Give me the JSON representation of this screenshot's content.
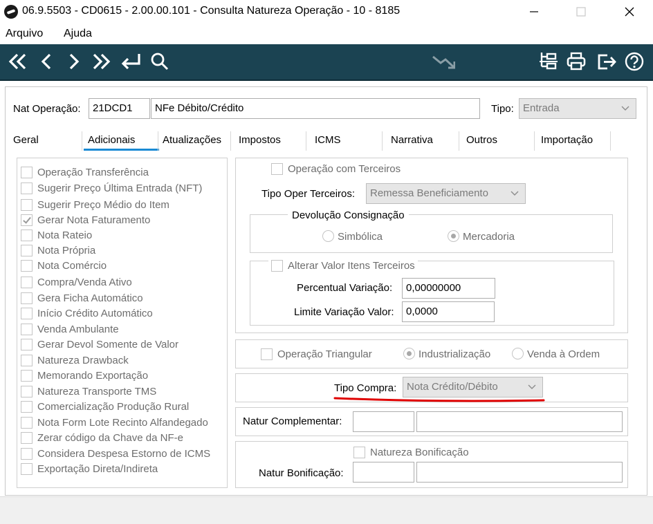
{
  "window": {
    "title": "06.9.5503 - CD0615 - 2.00.00.101 - Consulta Natureza Operação - 10 - 8185"
  },
  "menu": {
    "items": [
      "Arquivo",
      "Ajuda"
    ]
  },
  "toolbar": {
    "icons": [
      "first-icon",
      "prev-icon",
      "next-icon",
      "last-icon",
      "return-icon",
      "search-icon",
      "trend-down-icon",
      "tree-icon",
      "print-icon",
      "exit-icon",
      "help-icon"
    ]
  },
  "header": {
    "nat_label": "Nat Operação:",
    "nat_code": "21DCD1",
    "nat_desc": "NFe Débito/Crédito",
    "tipo_label": "Tipo:",
    "tipo_value": "Entrada"
  },
  "tabs": [
    "Geral",
    "Adicionais",
    "Atualizações",
    "Impostos",
    "ICMS",
    "Narrativa",
    "Outros",
    "Importação"
  ],
  "active_tab": "Adicionais",
  "checklist": [
    {
      "label": "Operação Transferência",
      "checked": false
    },
    {
      "label": "Sugerir Preço Última Entrada (NFT)",
      "checked": false
    },
    {
      "label": "Sugerir Preço Médio do Item",
      "checked": false
    },
    {
      "label": "Gerar Nota Faturamento",
      "checked": true
    },
    {
      "label": "Nota Rateio",
      "checked": false
    },
    {
      "label": "Nota Própria",
      "checked": false
    },
    {
      "label": "Nota Comércio",
      "checked": false
    },
    {
      "label": "Compra/Venda Ativo",
      "checked": false
    },
    {
      "label": "Gera Ficha Automático",
      "checked": false
    },
    {
      "label": "Início Crédito Automático",
      "checked": false
    },
    {
      "label": "Venda Ambulante",
      "checked": false
    },
    {
      "label": "Gerar Devol Somente de Valor",
      "checked": false
    },
    {
      "label": "Natureza Drawback",
      "checked": false
    },
    {
      "label": "Memorando Exportação",
      "checked": false
    },
    {
      "label": "Natureza Transporte TMS",
      "checked": false
    },
    {
      "label": "Comercialização Produção Rural",
      "checked": false
    },
    {
      "label": "Nota Form Lote Recinto Alfandegado",
      "checked": false
    },
    {
      "label": "Zerar código da Chave da NF-e",
      "checked": false
    },
    {
      "label": "Considera Despesa Estorno de ICMS",
      "checked": false
    },
    {
      "label": "Exportação Direta/Indireta",
      "checked": false
    }
  ],
  "terceiros": {
    "op_label": "Operação com Terceiros",
    "tipo_label": "Tipo Oper Terceiros:",
    "tipo_value": "Remessa Beneficiamento",
    "devolucao_title": "Devolução Consignação",
    "radio_simbolica": "Simbólica",
    "radio_mercadoria": "Mercadoria",
    "alterar_label": "Alterar Valor Itens Terceiros",
    "percentual_label": "Percentual Variação:",
    "percentual_value": "0,00000000",
    "limite_label": "Limite Variação Valor:",
    "limite_value": "0,0000"
  },
  "triangular": {
    "label": "Operação Triangular",
    "radio_industrializacao": "Industrialização",
    "radio_venda": "Venda à Ordem"
  },
  "compra": {
    "label": "Tipo Compra:",
    "value": "Nota Crédito/Débito",
    "highlight_color": "#e00000"
  },
  "complementar": {
    "label": "Natur Complementar:"
  },
  "bonificacao": {
    "check_label": "Natureza Bonificação",
    "label": "Natur Bonificação:"
  },
  "colors": {
    "toolbar_bg": "#1b4352",
    "tab_underline": "#1a8ad4"
  }
}
